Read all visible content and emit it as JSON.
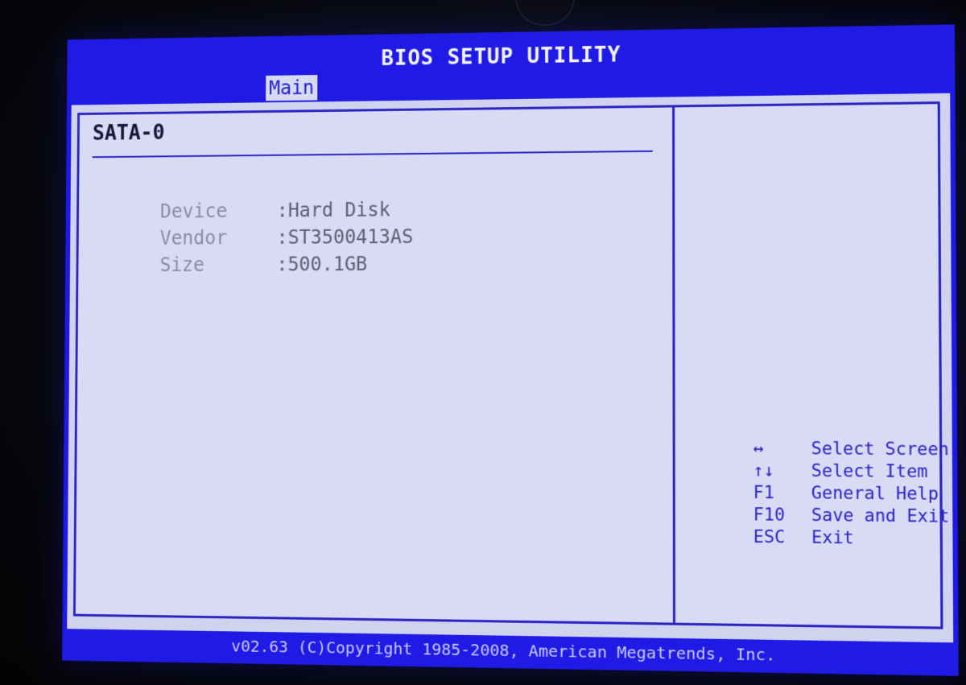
{
  "window": {
    "title": "BIOS SETUP UTILITY"
  },
  "tabs": [
    {
      "label": "Main",
      "active": true
    }
  ],
  "main": {
    "section_title": "SATA-0",
    "rows": [
      {
        "label": "Device",
        "value": ":Hard Disk"
      },
      {
        "label": "Vendor",
        "value": ":ST3500413AS"
      },
      {
        "label": "Size",
        "value": ":500.1GB"
      }
    ]
  },
  "help": {
    "items": [
      {
        "key": "↔",
        "desc": "Select Screen",
        "icon": "left-right-arrow-icon"
      },
      {
        "key": "↑↓",
        "desc": "Select Item",
        "icon": "up-down-arrow-icon"
      },
      {
        "key": "F1",
        "desc": "General Help"
      },
      {
        "key": "F10",
        "desc": "Save and Exit"
      },
      {
        "key": "ESC",
        "desc": "Exit"
      }
    ]
  },
  "footer": {
    "copyright": "v02.63 (C)Copyright 1985-2008, American Megatrends, Inc."
  },
  "colors": {
    "bios_blue": "#1f1ae6",
    "panel_bg": "#d8dbf3",
    "frame_line": "#2a24c4",
    "help_text": "#2a22c8",
    "dim_text": "#8a8ca4"
  }
}
